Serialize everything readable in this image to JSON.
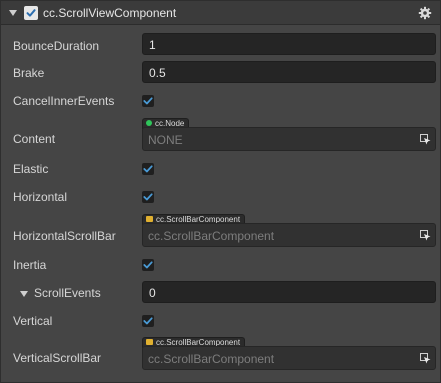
{
  "header": {
    "title": "cc.ScrollViewComponent",
    "enabled": true,
    "icons": [
      "collapse-arrow-icon",
      "gear-icon"
    ]
  },
  "properties": {
    "bounce_duration": {
      "label": "BounceDuration",
      "value": "1"
    },
    "brake": {
      "label": "Brake",
      "value": "0.5"
    },
    "cancel_inner_events": {
      "label": "CancelInnerEvents",
      "checked": true
    },
    "content": {
      "label": "Content",
      "type_tag": "cc.Node",
      "value": "NONE"
    },
    "elastic": {
      "label": "Elastic",
      "checked": true
    },
    "horizontal": {
      "label": "Horizontal",
      "checked": true
    },
    "horizontal_scroll_bar": {
      "label": "HorizontalScrollBar",
      "type_tag": "cc.ScrollBarComponent",
      "placeholder": "cc.ScrollBarComponent"
    },
    "inertia": {
      "label": "Inertia",
      "checked": true
    },
    "scroll_events": {
      "label": "ScrollEvents",
      "value": "0"
    },
    "vertical": {
      "label": "Vertical",
      "checked": true
    },
    "vertical_scroll_bar": {
      "label": "VerticalScrollBar",
      "type_tag": "cc.ScrollBarComponent",
      "placeholder": "cc.ScrollBarComponent"
    }
  },
  "colors": {
    "panel_bg": "#454545",
    "header_bg": "#3b3b3b",
    "input_bg": "#252525",
    "checkbox_accent": "#4a9bd6",
    "node_tag_dot": "#2fc55a"
  }
}
